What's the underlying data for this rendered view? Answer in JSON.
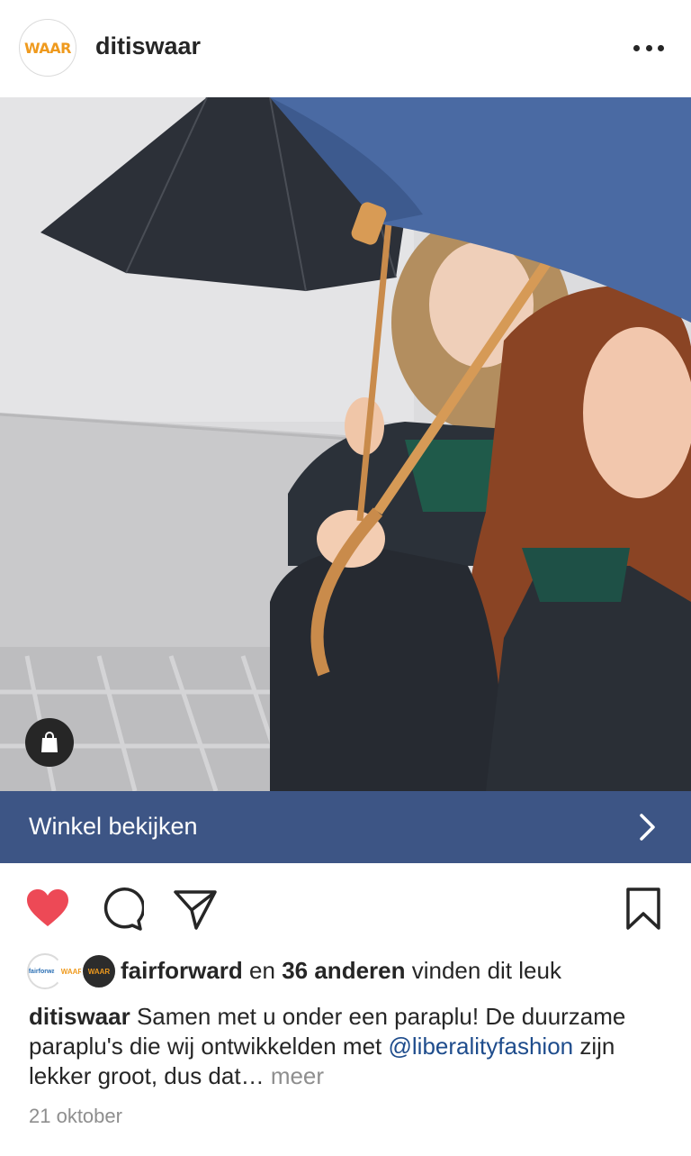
{
  "post": {
    "username": "ditiswaar",
    "avatar_logo": "WAAR",
    "more_icon": "more-horizontal-icon"
  },
  "shop": {
    "cta_label": "Winkel bekijken",
    "cta_color": "#3d5585",
    "badge_icon": "shopping-bag-icon"
  },
  "actions": {
    "like_icon": "heart-filled-icon",
    "like_color": "#ed4956",
    "comment_icon": "comment-icon",
    "share_icon": "send-icon",
    "save_icon": "bookmark-icon"
  },
  "likes": {
    "avatar_1_logo": "fairforward",
    "avatar_2_logo": "WAAR",
    "avatar_3_logo": "WAAR",
    "first_user": "fairforward",
    "connector": "en",
    "others": "36 anderen",
    "suffix": "vinden dit leuk"
  },
  "caption": {
    "username": "ditiswaar",
    "text_1": "Samen met u onder een paraplu! De duurzame paraplu's die wij ontwikkelden met",
    "mention": "@liberalityfashion",
    "text_2": "zijn lekker groot, dus dat…",
    "more_label": "meer"
  },
  "date": "21 oktober"
}
